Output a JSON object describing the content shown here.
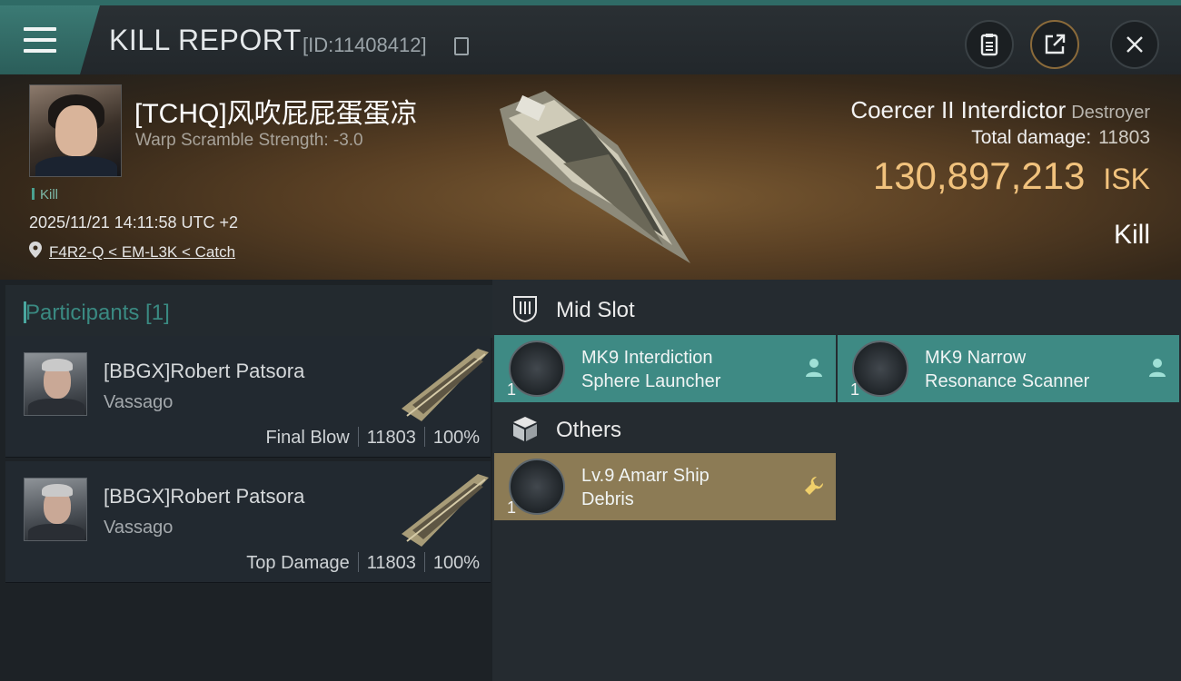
{
  "header": {
    "title": "KILL REPORT",
    "report_id": "[ID:11408412]",
    "icons": [
      "menu-icon",
      "copy-icon",
      "clipboard-icon",
      "share-icon",
      "close-icon"
    ]
  },
  "victim": {
    "name": "[TCHQ]风吹屁屁蛋蛋凉",
    "warp_scramble": "Warp Scramble Strength: -3.0",
    "kill_tag": "Kill",
    "datetime": "2025/11/21 14:11:58 UTC +2",
    "location": "F4R2-Q < EM-L3K < Catch",
    "ship_name": "Coercer II Interdictor",
    "ship_class": "Destroyer",
    "total_damage_label": "Total damage:",
    "total_damage": "11803",
    "isk_value": "130,897,213",
    "isk_unit": "ISK",
    "result": "Kill"
  },
  "participants": {
    "header": "Participants [1]",
    "rows": [
      {
        "name": "[BBGX]Robert Patsora",
        "ship": "Vassago",
        "role": "Final Blow",
        "damage": "11803",
        "percent": "100%"
      },
      {
        "name": "[BBGX]Robert Patsora",
        "ship": "Vassago",
        "role": "Top Damage",
        "damage": "11803",
        "percent": "100%"
      }
    ]
  },
  "fitting": {
    "mid_slot": {
      "label": "Mid Slot",
      "items": [
        {
          "qty": "1",
          "line1": "MK9 Interdiction",
          "line2": "Sphere Launcher"
        },
        {
          "qty": "1",
          "line1": "MK9 Narrow",
          "line2": "Resonance Scanner"
        }
      ]
    },
    "others": {
      "label": "Others",
      "items": [
        {
          "qty": "1",
          "line1": "Lv.9 Amarr Ship",
          "line2": "Debris"
        }
      ]
    }
  },
  "colors": {
    "accent_teal": "#3e8a84",
    "isk_gold": "#f1c27d",
    "item_gold": "#8c7b55"
  }
}
